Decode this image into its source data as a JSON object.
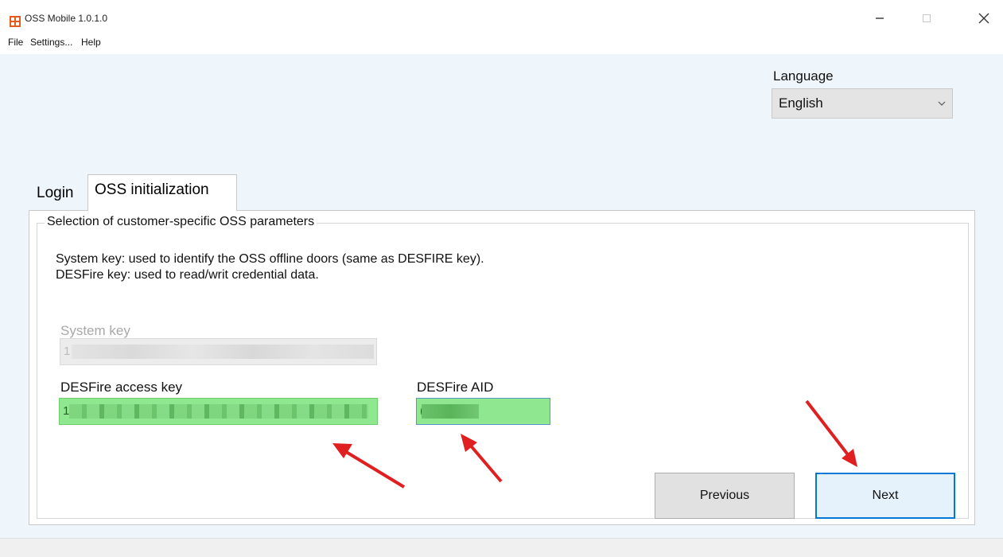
{
  "window": {
    "title": "OSS Mobile 1.0.1.0",
    "icon": "app-logo-icon",
    "controls": [
      "minimize-icon",
      "maximize-icon",
      "close-icon"
    ]
  },
  "menu": {
    "items": [
      "File",
      "Settings...",
      "Help"
    ]
  },
  "language": {
    "label": "Language",
    "selected": "English"
  },
  "tabs": [
    {
      "label": "Login",
      "active": false
    },
    {
      "label": "OSS initialization",
      "active": true
    }
  ],
  "group": {
    "title": "Selection of customer-specific OSS parameters",
    "descriptions": [
      "System key:  used to identify the OSS offline doors (same as DESFIRE key).",
      "DESFire key: used to read/writ credential data."
    ]
  },
  "fields": {
    "system_key": {
      "label": "System key",
      "value": "1",
      "enabled": false
    },
    "desfire_access_key": {
      "label": "DESFire access key",
      "value": "1"
    },
    "desfire_aid": {
      "label": "DESFire AID",
      "value": "("
    }
  },
  "buttons": {
    "previous": "Previous",
    "next": "Next"
  },
  "annotations": {
    "arrow_icon": "red-arrow-icon",
    "arrow_color": "#e02020"
  },
  "colors": {
    "highlight_green": "#8fe88f",
    "focus_blue": "#0078d7",
    "client_background": "#eef5fb"
  }
}
